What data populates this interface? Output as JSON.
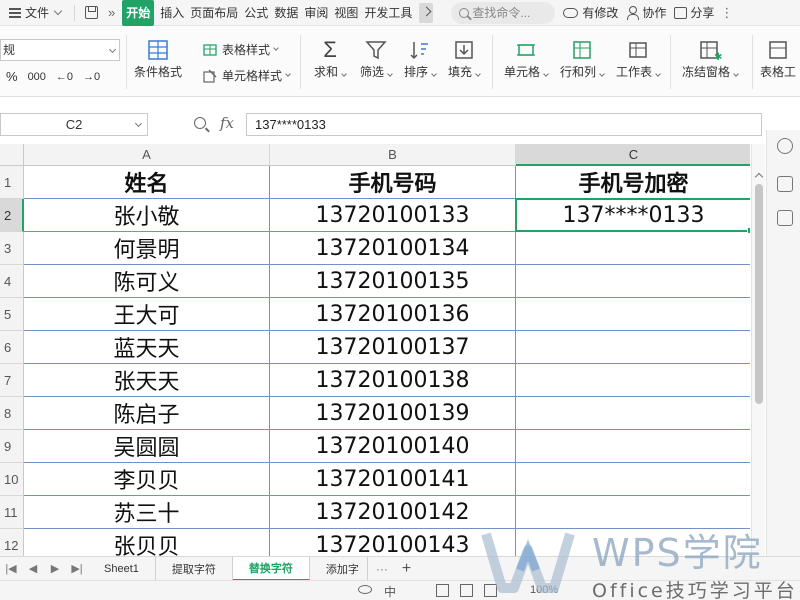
{
  "menubar": {
    "file_label": "文件",
    "tabs": [
      "开始",
      "插入",
      "页面布局",
      "公式",
      "数据",
      "审阅",
      "视图",
      "开发工具"
    ],
    "active_tab": "开始",
    "search_placeholder": "查找命令...",
    "actions": [
      "有修改",
      "协作",
      "分享"
    ]
  },
  "ribbon": {
    "font_name": "规",
    "percent": "%",
    "thousands": "000",
    "dec_inc": "←0",
    "dec_dec": "→0",
    "table_style": "表格样式",
    "cell_style": "单元格样式",
    "buttons": [
      "条件格式",
      "求和",
      "筛选",
      "排序",
      "填充",
      "单元格",
      "行和列",
      "工作表",
      "冻结窗格",
      "表格工"
    ]
  },
  "formula_bar": {
    "cell_ref": "C2",
    "fx_label": "fx",
    "content": "137****0133"
  },
  "grid": {
    "columns": [
      "A",
      "B",
      "C"
    ],
    "selected_column": "C",
    "rows": [
      "1",
      "2",
      "3",
      "4",
      "5",
      "6",
      "7",
      "8",
      "9",
      "10",
      "11",
      "12"
    ],
    "selected_row": "2",
    "data": [
      [
        "姓名",
        "手机号码",
        "手机号加密"
      ],
      [
        "张小敬",
        "13720100133",
        "137****0133"
      ],
      [
        "何景明",
        "13720100134",
        ""
      ],
      [
        "陈可义",
        "13720100135",
        ""
      ],
      [
        "王大可",
        "13720100136",
        ""
      ],
      [
        "蓝天天",
        "13720100137",
        ""
      ],
      [
        "张天天",
        "13720100138",
        ""
      ],
      [
        "陈启子",
        "13720100139",
        ""
      ],
      [
        "吴圆圆",
        "13720100140",
        ""
      ],
      [
        "李贝贝",
        "13720100141",
        ""
      ],
      [
        "苏三十",
        "13720100142",
        ""
      ],
      [
        "张贝贝",
        "13720100143",
        ""
      ]
    ]
  },
  "sheet_tabs": [
    "Sheet1",
    "提取字符",
    "替换字符",
    "添加字"
  ],
  "active_sheet": "替换字符",
  "status": {
    "input_mode": "中",
    "zoom": "100%"
  },
  "watermark": {
    "title": "WPS学院",
    "subtitle": "Office技巧学习平台"
  },
  "colors": {
    "accent": "#21a366",
    "cell_border": "#6f93c5"
  }
}
